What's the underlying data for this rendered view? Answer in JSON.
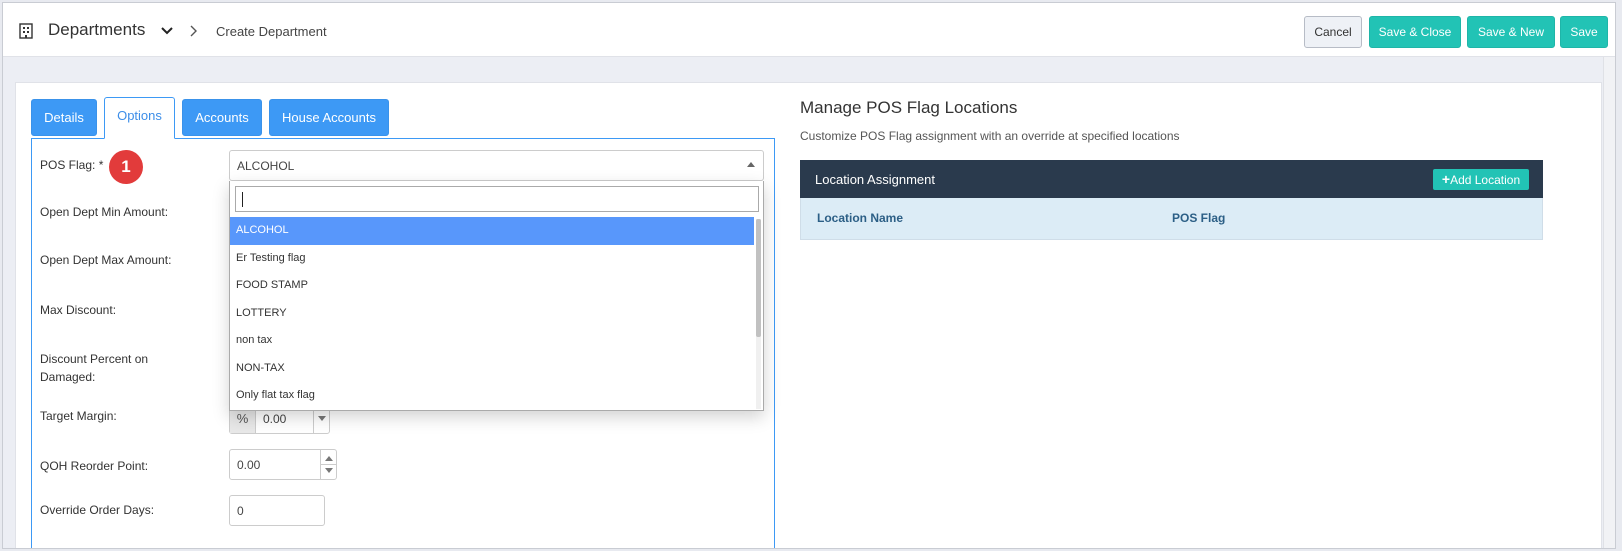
{
  "header": {
    "title": "Departments",
    "breadcrumb": "Create Department",
    "buttons": {
      "cancel": "Cancel",
      "save_close": "Save & Close",
      "save_new": "Save & New",
      "save": "Save"
    }
  },
  "tabs": [
    {
      "label": "Details"
    },
    {
      "label": "Options"
    },
    {
      "label": "Accounts"
    },
    {
      "label": "House Accounts"
    }
  ],
  "form": {
    "pos_flag_label": "POS Flag: *",
    "badge": "1",
    "pos_flag_value": "ALCOHOL",
    "open_min_label": "Open Dept Min Amount:",
    "open_max_label": "Open Dept Max Amount:",
    "max_discount_label": "Max Discount:",
    "discount_damaged_label_1": "Discount Percent on",
    "discount_damaged_label_2": "Damaged:",
    "target_margin_label": "Target Margin:",
    "target_margin_addon": "%",
    "target_margin_value": "0.00",
    "qoh_label": "QOH Reorder Point:",
    "qoh_value": "0.00",
    "override_days_label": "Override Order Days:",
    "override_days_value": "0"
  },
  "dropdown": {
    "search_value": "",
    "options": [
      "ALCOHOL",
      "Er Testing flag",
      "FOOD STAMP",
      "LOTTERY",
      "non tax",
      "NON-TAX",
      "Only flat tax flag"
    ],
    "selected": "ALCOHOL"
  },
  "right": {
    "title": "Manage POS Flag Locations",
    "subtitle": "Customize POS Flag assignment with an override at specified locations",
    "table_title": "Location Assignment",
    "add_button": "Add Location",
    "columns": [
      "Location Name",
      "POS Flag"
    ]
  },
  "colors": {
    "tab_blue": "#3d99f5",
    "teal": "#22c3b5",
    "header_dark": "#2a3a4d",
    "badge_red": "#e23b3b",
    "selected_option": "#5897fb"
  }
}
